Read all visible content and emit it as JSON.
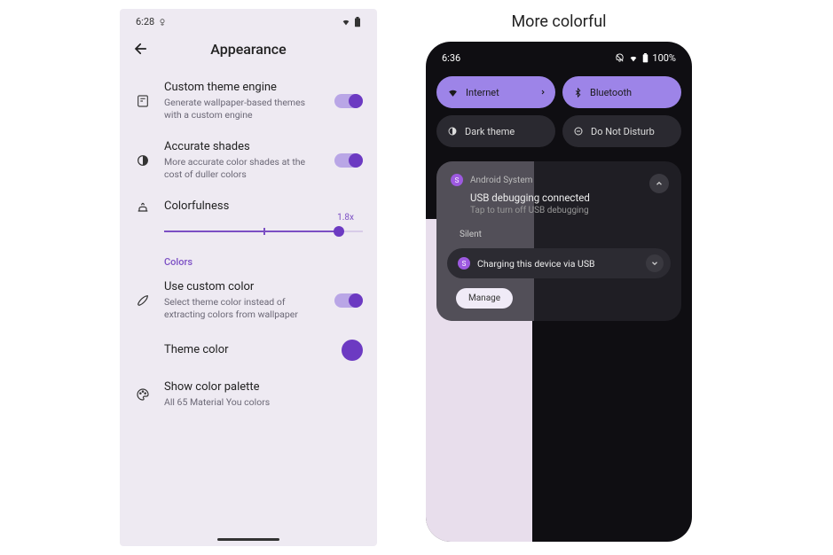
{
  "right_header": "More colorful",
  "left_phone": {
    "status": {
      "time": "6:28",
      "icons": {
        "left": "alarm",
        "right": [
          "wifi",
          "battery"
        ]
      }
    },
    "page_title": "Appearance",
    "settings": {
      "custom_theme": {
        "title": "Custom theme engine",
        "desc": "Generate wallpaper-based themes with a custom engine",
        "toggle": true
      },
      "accurate_shades": {
        "title": "Accurate shades",
        "desc": "More accurate color shades at the cost of duller colors",
        "toggle": true
      },
      "colorfulness": {
        "title": "Colorfulness",
        "value_label": "1.8x",
        "value_fraction": 0.88
      },
      "section_colors": "Colors",
      "use_custom_color": {
        "title": "Use custom color",
        "desc": "Select theme color instead of extracting colors from wallpaper",
        "toggle": true
      },
      "theme_color": {
        "title": "Theme color",
        "color": "#6c3ac2"
      },
      "show_palette": {
        "title": "Show color palette",
        "desc": "All 65 Material You colors"
      }
    }
  },
  "right_phone": {
    "status": {
      "time": "6:36",
      "battery": "100%"
    },
    "qs": {
      "internet": "Internet",
      "bluetooth": "Bluetooth",
      "dark_theme": "Dark theme",
      "dnd": "Do Not Disturb"
    },
    "notif1": {
      "app": "Android System",
      "title": "USB debugging connected",
      "sub": "Tap to turn off USB debugging"
    },
    "silent_label": "Silent",
    "notif2": {
      "title": "Charging this device via USB"
    },
    "manage": "Manage"
  }
}
